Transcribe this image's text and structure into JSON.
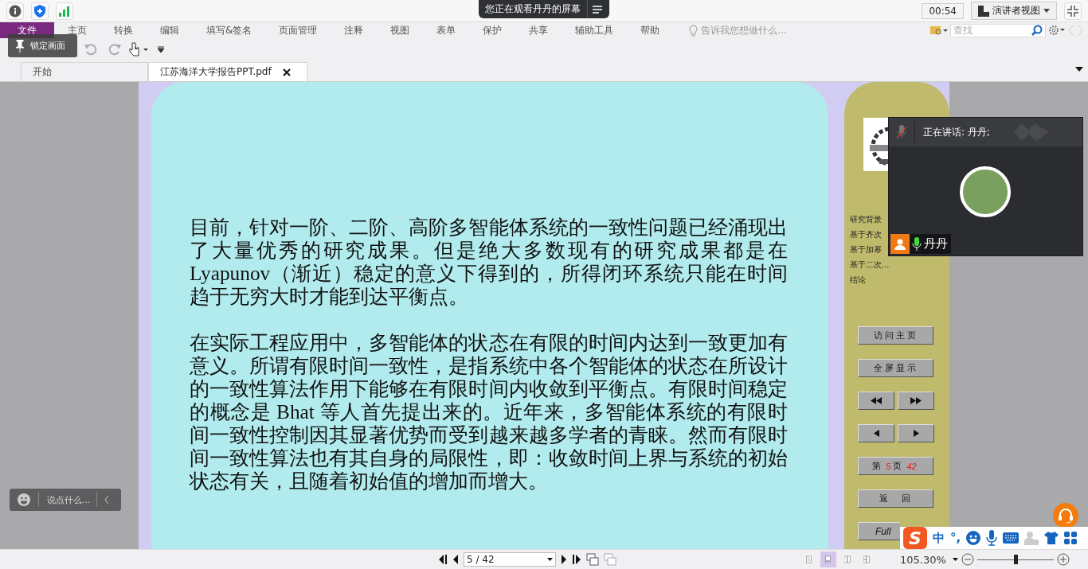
{
  "share_banner": {
    "text": "您正在观看丹丹的屏幕"
  },
  "timer": "00:54",
  "view_button": {
    "label": "演讲者视图"
  },
  "menu": [
    {
      "label": "文件",
      "selected": true
    },
    {
      "label": "主页",
      "selected": false
    },
    {
      "label": "转换",
      "selected": false
    },
    {
      "label": "编辑",
      "selected": false
    },
    {
      "label": "填写&签名",
      "selected": false
    },
    {
      "label": "页面管理",
      "selected": false
    },
    {
      "label": "注释",
      "selected": false
    },
    {
      "label": "视图",
      "selected": false
    },
    {
      "label": "表单",
      "selected": false
    },
    {
      "label": "保护",
      "selected": false
    },
    {
      "label": "共享",
      "selected": false
    },
    {
      "label": "辅助工具",
      "selected": false
    },
    {
      "label": "帮助",
      "selected": false
    }
  ],
  "tell_me": {
    "placeholder": "告诉我您想做什么..."
  },
  "search": {
    "placeholder": "查找"
  },
  "lock_tooltip": "锁定画面",
  "tabs": [
    {
      "label": "开始",
      "selected": false
    },
    {
      "label": "江苏海洋大学报告PPT.pdf",
      "selected": true
    }
  ],
  "slide": {
    "paragraphs": [
      "目前，针对一阶、二阶、高阶多智能体系统的一致性问题已经涌现出了大量优秀的研究成果。但是绝大多数现有的研究成果都是在 Lyapunov（渐近）稳定的意义下得到的，所得闭环系统只能在时间趋于无穷大时才能到达平衡点。",
      "在实际工程应用中，多智能体的状态在有限的时间内达到一致更加有意义。所谓有限时间一致性，是指系统中各个智能体的状态在所设计的一致性算法作用下能够在有限时间内收敛到平衡点。有限时间稳定的概念是 Bhat 等人首先提出来的。近年来，多智能体系统的有限时间一致性控制因其显著优势而受到越来越多学者的青睐。然而有限时间一致性算法也有其自身的局限性，即：收敛时间上界与系统的初始状态有关，且随着初始值的增加而增大。"
    ],
    "nav_items": [
      "研究背景",
      "基于齐次",
      "基于加幂",
      "基于二次...",
      "结论"
    ],
    "buttons": [
      {
        "kind": "text",
        "label": "访问主页"
      },
      {
        "kind": "text",
        "label": "全屏显示"
      },
      {
        "kind": "fast-pair"
      },
      {
        "kind": "step-pair"
      },
      {
        "kind": "page",
        "prefix": "第",
        "current": "5",
        "middle": "页",
        "total": "42"
      },
      {
        "kind": "text",
        "label": "返　回"
      },
      {
        "kind": "italic",
        "label": "Full"
      }
    ]
  },
  "chat": {
    "placeholder": "说点什么..."
  },
  "video": {
    "speaking": "正在讲话: 丹丹;",
    "name": "丹丹"
  },
  "ime": {
    "logo": "S",
    "mode": "中",
    "punct": "°,"
  },
  "bottom": {
    "page": "5 / 42",
    "zoom": "105.30%",
    "zoom_slider": {
      "level": 0.5
    },
    "views": [
      {
        "kind": "single",
        "selected": false
      },
      {
        "kind": "continuous",
        "selected": true
      },
      {
        "kind": "facing",
        "selected": false
      },
      {
        "kind": "cover",
        "selected": false
      }
    ]
  }
}
